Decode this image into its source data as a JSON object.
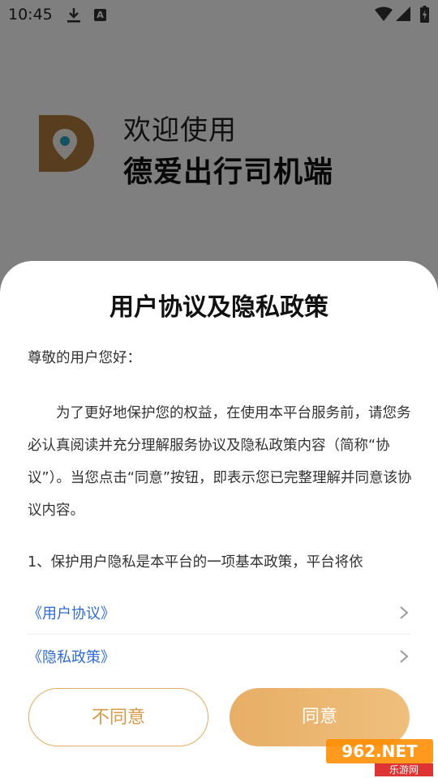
{
  "status_bar": {
    "time": "10:45",
    "a_label": "A"
  },
  "welcome": {
    "line1": "欢迎使用",
    "line2": "德爱出行司机端"
  },
  "dialog": {
    "title": "用户协议及隐私政策",
    "greeting": "尊敬的用户您好：",
    "para1": "为了更好地保护您的权益，在使用本平台服务前，请您务必认真阅读并充分理解服务协议及隐私政策内容（简称“协议”）。当您点击“同意”按钮，即表示您已完整理解并同意该协议内容。",
    "para2": "1、保护用户隐私是本平台的一项基本政策，平台将依",
    "links": [
      {
        "label": "《用户协议》"
      },
      {
        "label": "《隐私政策》"
      }
    ],
    "buttons": {
      "disagree": "不同意",
      "agree": "同意"
    }
  },
  "watermark": {
    "main": "962.NET",
    "sub": "乐游网"
  },
  "colors": {
    "accent": "#e7ae66",
    "link": "#2f6bd6",
    "logo": "#b07a3c"
  }
}
